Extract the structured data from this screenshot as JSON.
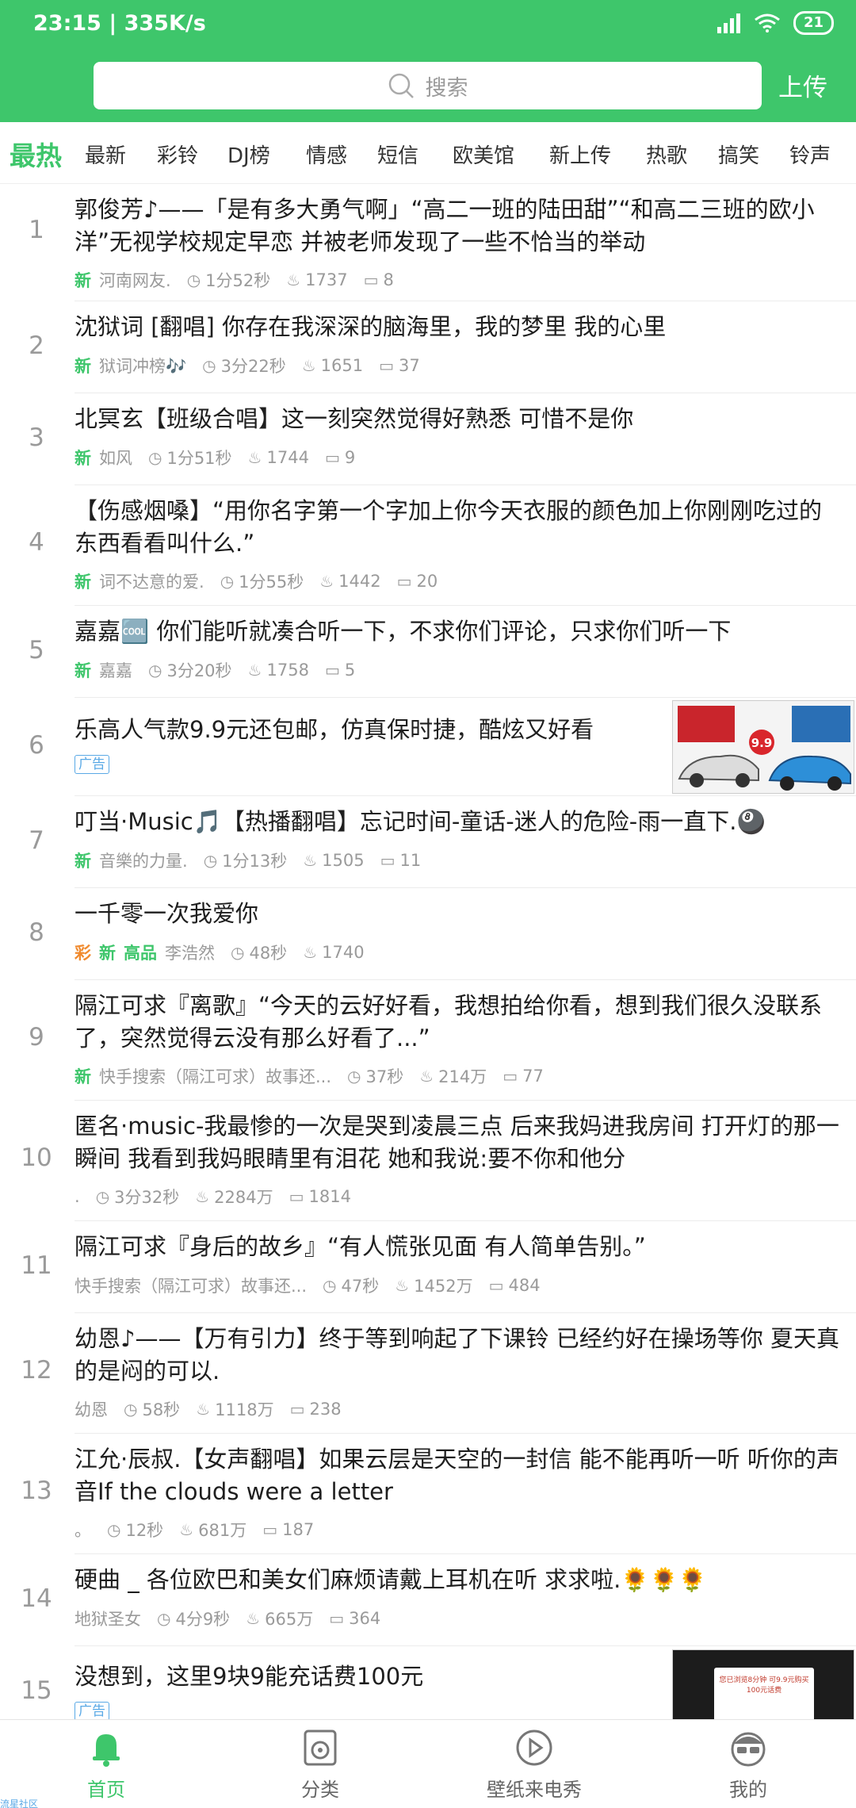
{
  "status": {
    "time": "23:15 | 335K/s",
    "battery": "21"
  },
  "search": {
    "placeholder": "搜索"
  },
  "upload_label": "上传",
  "tabs": [
    "最热",
    "最新",
    "彩铃",
    "DJ榜",
    "情感",
    "短信",
    "欧美馆",
    "新上传",
    "热歌",
    "搞笑",
    "铃声"
  ],
  "colors": {
    "accent": "#3ec66b",
    "ad": "#5aa9e6",
    "cai": "#f08a2e"
  },
  "items": [
    {
      "rank": "1",
      "title": "郭俊芳♪——「是有多大勇气啊」“高二一班的陆田甜”“和高二三班的欧小洋”无视学校规定早恋 并被老师发现了一些不恰当的举动",
      "tag": "新",
      "source": "河南网友.",
      "duration": "1分52秒",
      "likes": "1737",
      "comments": "8"
    },
    {
      "rank": "2",
      "title": "沈狱词 [翻唱] 你存在我深深的脑海里，我的梦里 我的心里",
      "tag": "新",
      "source": "狱词冲榜🎶",
      "duration": "3分22秒",
      "likes": "1651",
      "comments": "37"
    },
    {
      "rank": "3",
      "title": "北冥玄【班级合唱】这一刻突然觉得好熟悉 可惜不是你",
      "tag": "新",
      "source": "如风",
      "duration": "1分51秒",
      "likes": "1744",
      "comments": "9"
    },
    {
      "rank": "4",
      "title": "【伤感烟嗓】“用你名字第一个字加上你今天衣服的颜色加上你刚刚吃过的东西看看叫什么.”",
      "tag": "新",
      "source": "词不达意的爱.",
      "duration": "1分55秒",
      "likes": "1442",
      "comments": "20"
    },
    {
      "rank": "5",
      "title": "嘉嘉🆒 你们能听就凑合听一下，不求你们评论，只求你们听一下",
      "tag": "新",
      "source": "嘉嘉",
      "duration": "3分20秒",
      "likes": "1758",
      "comments": "5"
    },
    {
      "rank": "6",
      "title": "乐高人气款9.9元还包邮，仿真保时捷，酷炫又好看",
      "ad_label": "广告",
      "ad_badge": "9.9"
    },
    {
      "rank": "7",
      "title": "叮当·Music🎵【热播翻唱】忘记时间-童话-迷人的危险-雨一直下.🎱",
      "tag": "新",
      "source": "音樂的力量.",
      "duration": "1分13秒",
      "likes": "1505",
      "comments": "11"
    },
    {
      "rank": "8",
      "title": "一千零一次我爱你",
      "tag_cai": "彩",
      "tag": "新",
      "tag_hq": "高品",
      "source": "李浩然",
      "duration": "48秒",
      "likes": "1740"
    },
    {
      "rank": "9",
      "title": "隔江可求『离歌』“今天的云好好看，我想拍给你看，想到我们很久没联系了，突然觉得云没有那么好看了...”",
      "tag": "新",
      "source": "快手搜索（隔江可求）故事还...",
      "duration": "37秒",
      "likes": "214万",
      "comments": "77"
    },
    {
      "rank": "10",
      "title": "匿名·music-我最惨的一次是哭到凌晨三点 后来我妈进我房间 打开灯的那一瞬间 我看到我妈眼睛里有泪花 她和我说:要不你和他分",
      "source": ".",
      "duration": "3分32秒",
      "likes": "2284万",
      "comments": "1814"
    },
    {
      "rank": "11",
      "title": "隔江可求『身后的故乡』“有人慌张见面 有人简单告别。”",
      "source": "快手搜索（隔江可求）故事还...",
      "duration": "47秒",
      "likes": "1452万",
      "comments": "484"
    },
    {
      "rank": "12",
      "title": "幼恩♪——【万有引力】终于等到响起了下课铃 已经约好在操场等你 夏天真的是闷的可以.",
      "source": "幼恩",
      "duration": "58秒",
      "likes": "1118万",
      "comments": "238"
    },
    {
      "rank": "13",
      "title": "江允·辰叔.【女声翻唱】如果云层是天空的一封信 能不能再听一听 听你的声音If the clouds were a letter",
      "source": "。",
      "duration": "12秒",
      "likes": "681万",
      "comments": "187"
    },
    {
      "rank": "14",
      "title": "硬曲 _ 各位欧巴和美女们麻烦请戴上耳机在听 求求啦.🌻🌻🌻",
      "source": "地狱圣女",
      "duration": "4分9秒",
      "likes": "665万",
      "comments": "364"
    },
    {
      "rank": "15",
      "title": "没想到，这里9块9能充话费100元",
      "ad_label": "广告",
      "ad_text": "您已浏览8分钟 可9.9元购买100元话费"
    }
  ],
  "bottom_nav": [
    {
      "label": "首页",
      "icon": "bell-icon"
    },
    {
      "label": "分类",
      "icon": "speaker-icon"
    },
    {
      "label": "壁纸来电秀",
      "icon": "play-icon"
    },
    {
      "label": "我的",
      "icon": "avatar-icon"
    }
  ],
  "community_label": "流星社区"
}
